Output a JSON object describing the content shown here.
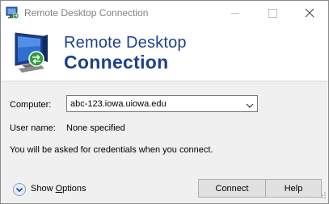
{
  "window": {
    "title": "Remote Desktop Connection"
  },
  "banner": {
    "line1": "Remote Desktop",
    "line2": "Connection",
    "title_color": "#1e3f8f"
  },
  "form": {
    "computer_label": "Computer:",
    "computer_value": "abc-123.iowa.uiowa.edu",
    "username_label": "User name:",
    "username_value": "None specified",
    "info": "You will be asked for credentials when you connect."
  },
  "footer": {
    "show_options_prefix": "Show ",
    "show_options_underlined": "O",
    "show_options_suffix": "ptions",
    "connect_label": "Connect",
    "help_label": "Help"
  },
  "icons": {
    "app": "remote-desktop-icon",
    "minimize": "minimize-icon",
    "maximize": "maximize-icon",
    "close": "close-icon",
    "dropdown": "chevron-down-icon",
    "options": "expand-circle-icon"
  }
}
